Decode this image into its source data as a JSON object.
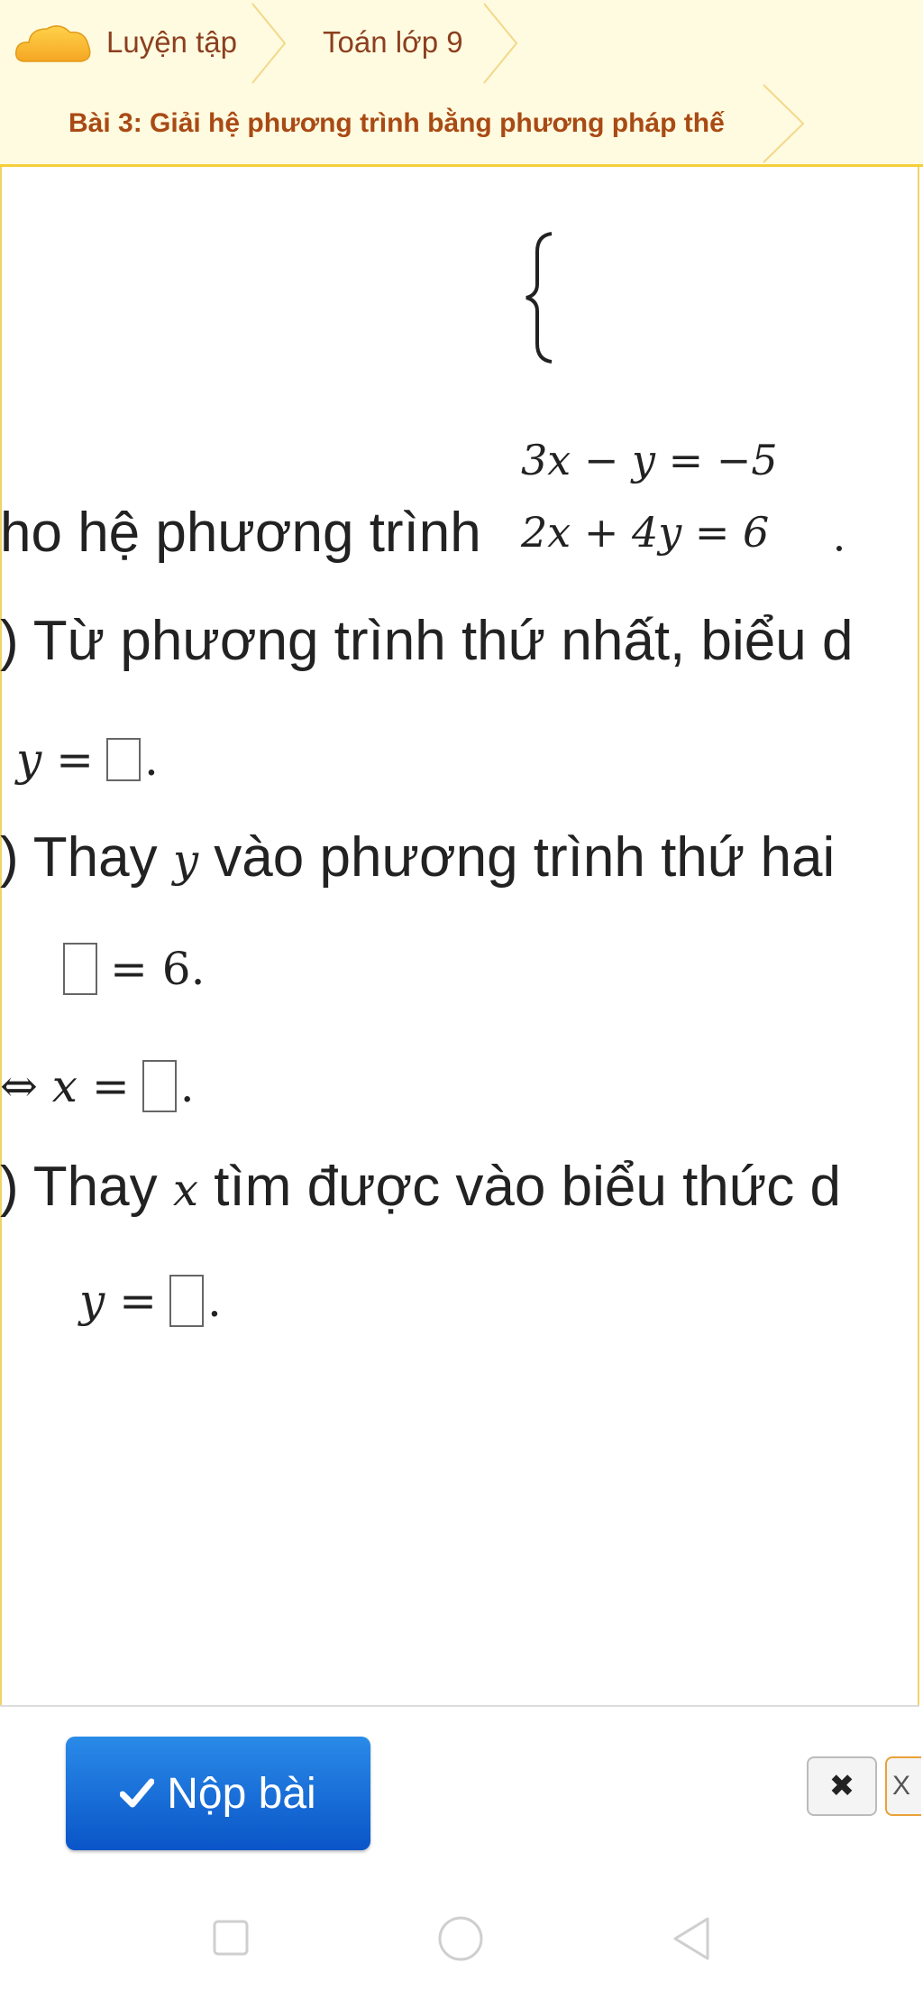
{
  "breadcrumb": {
    "item1": "Luyện tập",
    "item2": "Toán lớp 9"
  },
  "lesson": {
    "title": "Bài 3: Giải hệ phương trình bằng phương pháp thế"
  },
  "problem": {
    "intro": "ho hệ phương trình",
    "eq1": "3x − y = −5",
    "eq2": "2x + 4y = 6",
    "step1_label": ") Từ phương trình thứ nhất, biểu d",
    "step1_expr_lhs": "y =",
    "step1_expr_end": ".",
    "step2_label_pre": ") Thay ",
    "step2_var": "y",
    "step2_label_post": " vào phương trình thứ hai",
    "step2_expr_rhs": "= 6.",
    "step2b_lhs": "⇔ x =",
    "step2b_end": ".",
    "step3_label_pre": ") Thay ",
    "step3_var": "x",
    "step3_label_post": " tìm được vào biểu thức d",
    "step3_expr_lhs": "y =",
    "step3_expr_end": "."
  },
  "footer": {
    "submit_label": "Nộp bài",
    "clear_label": "✖",
    "next_label": "X"
  }
}
